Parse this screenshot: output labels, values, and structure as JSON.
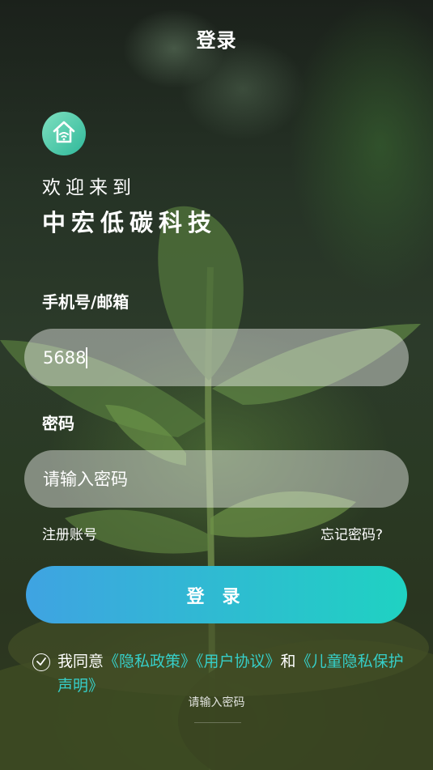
{
  "header": {
    "title": "登录"
  },
  "welcome": {
    "line1": "欢迎来到",
    "company": "中宏低碳科技"
  },
  "form": {
    "phone_label": "手机号/邮箱",
    "phone_value": "5688",
    "password_label": "密码",
    "password_placeholder": "请输入密码"
  },
  "links": {
    "register": "注册账号",
    "forgot": "忘记密码?"
  },
  "login_button": "登 录",
  "agreement": {
    "prefix": "我同意",
    "privacy": "《隐私政策》",
    "user": "《用户协议》",
    "and": "和",
    "child": "《儿童隐私保护声明》",
    "checked": true
  },
  "toast": "请输入密码",
  "colors": {
    "accent": "#36cfc9",
    "button_start": "#3fa3e2",
    "button_end": "#1fd2c2"
  },
  "icons": {
    "logo": "home-wifi-icon",
    "check": "check-icon"
  }
}
